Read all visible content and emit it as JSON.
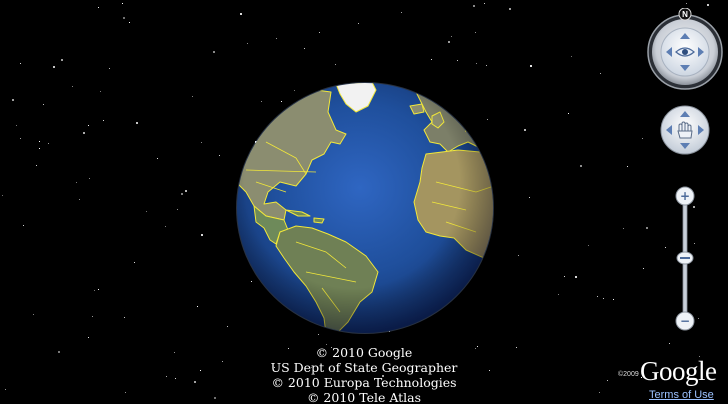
{
  "map": {
    "view": "globe-earth",
    "visible_regions": [
      "North America",
      "South America",
      "Greenland",
      "Atlantic Ocean",
      "Europe",
      "Africa"
    ],
    "colors": {
      "space": "#000000",
      "ocean": "#1f4f9c",
      "borders": "#f2e83a",
      "land": "#8c8f73"
    }
  },
  "attribution": {
    "lines": [
      "© 2010 Google",
      "US Dept of State Geographer",
      "© 2010 Europa Technologies",
      "© 2010 Tele Atlas"
    ]
  },
  "controls": {
    "compass": {
      "north_label": "N"
    },
    "zoom": {
      "plus_label": "+",
      "minus_label": "−",
      "level": 0.5
    },
    "icons": {
      "up": "chevron-up-icon",
      "down": "chevron-down-icon",
      "left": "chevron-left-icon",
      "right": "chevron-right-icon",
      "look": "eye-icon",
      "move": "hand-icon"
    }
  },
  "branding": {
    "copyright_year": "©2009",
    "logo_text": "Google",
    "terms_label": "Terms of Use"
  }
}
